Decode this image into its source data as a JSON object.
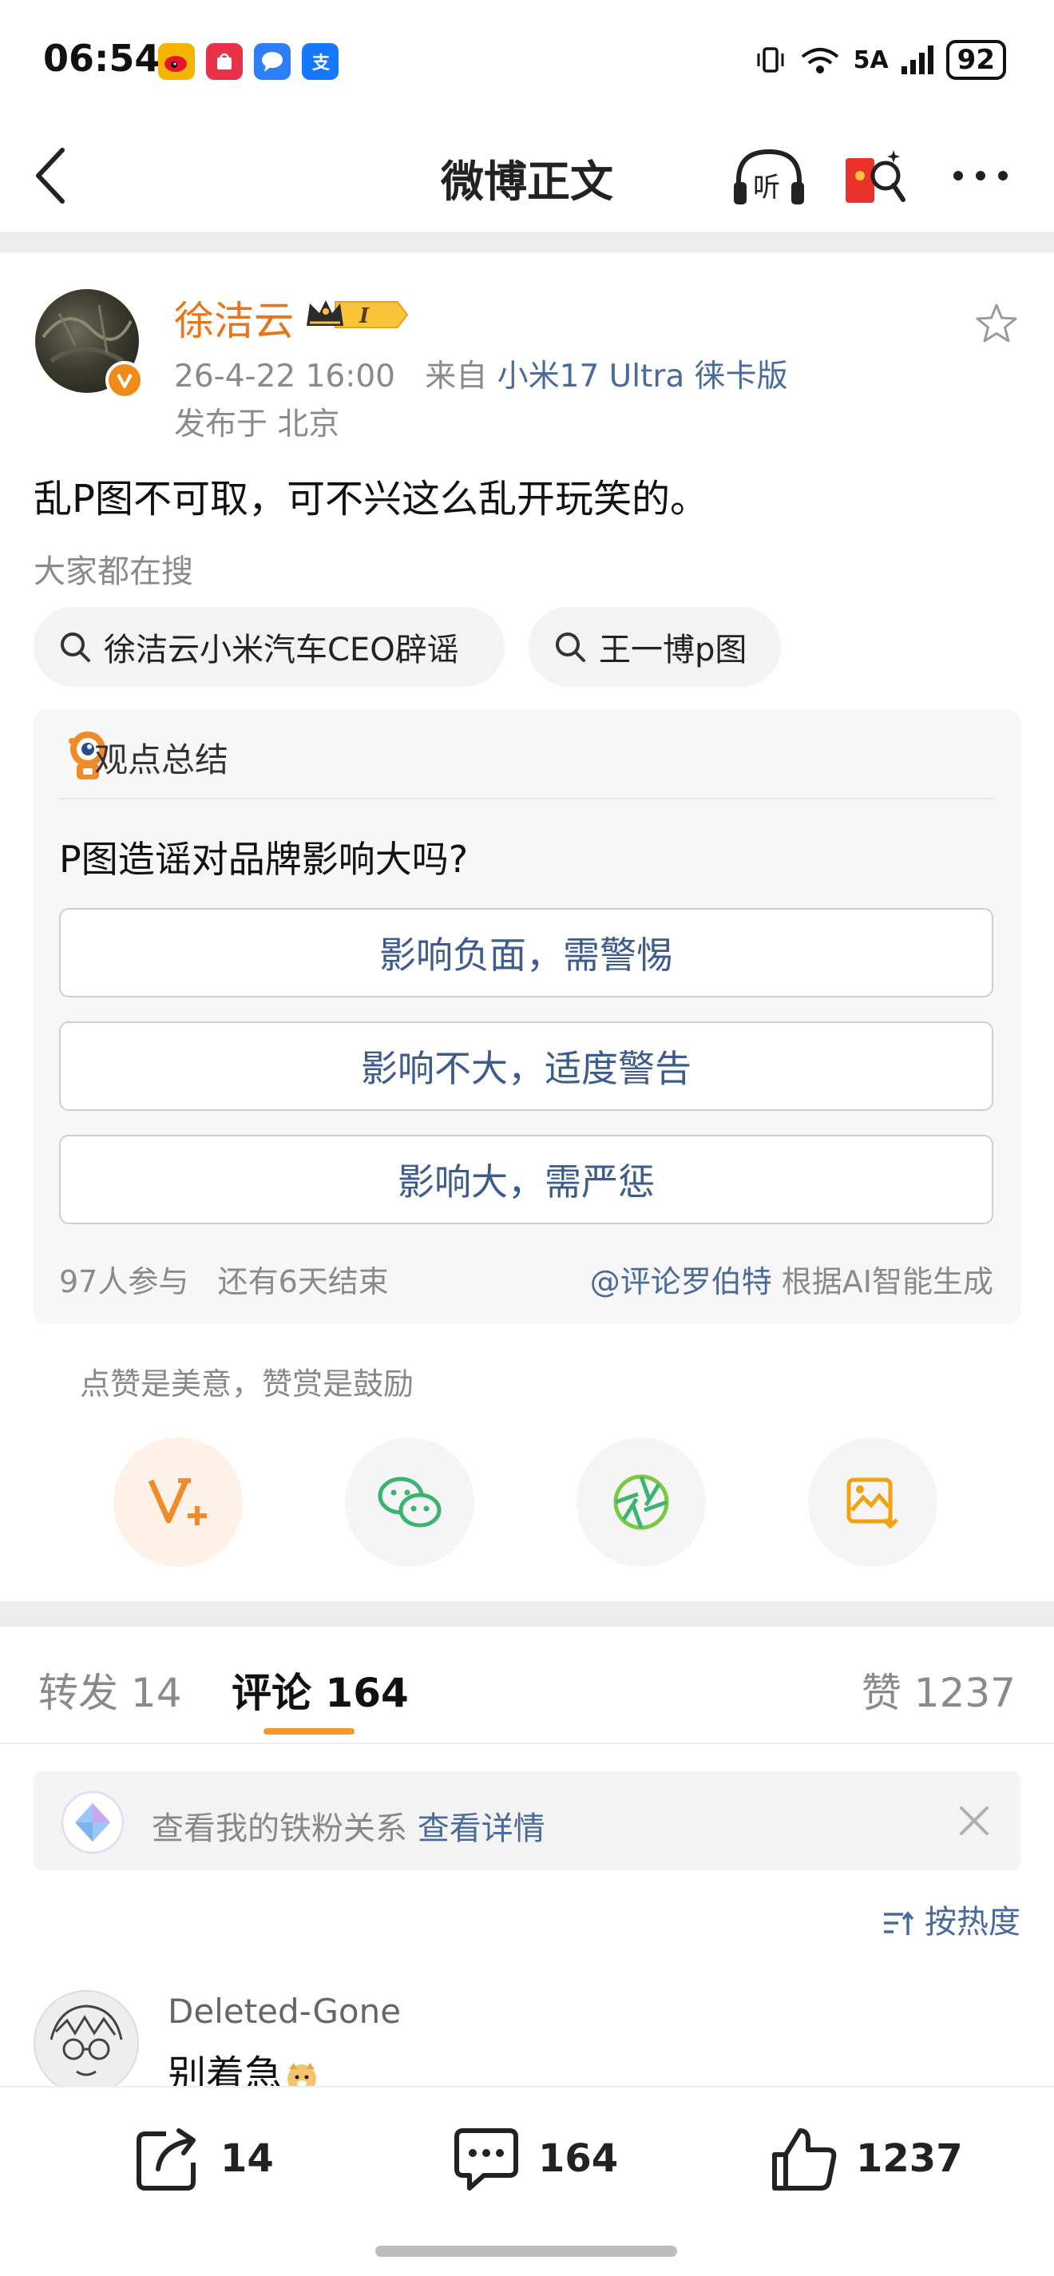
{
  "status_bar": {
    "time": "06:54",
    "network": "5A",
    "battery": "92",
    "apps": [
      "weibo-icon",
      "app-gallery-icon",
      "messages-icon",
      "alipay-icon"
    ]
  },
  "nav": {
    "title": "微博正文",
    "listen_label": "听"
  },
  "post": {
    "author": "徐洁云",
    "badge_text": "I",
    "timestamp": "26-4-22 16:00",
    "from_label": "来自",
    "source": "小米17 Ultra 徕卡版",
    "location": "发布于 北京",
    "text": "乱P图不可取，可不兴这么乱开玩笑的。"
  },
  "search": {
    "label": "大家都在搜",
    "chips": [
      "徐洁云小米汽车CEO辟谣",
      "王一博p图"
    ]
  },
  "poll": {
    "header": "观点总结",
    "question": "P图造谣对品牌影响大吗?",
    "options": [
      "影响负面，需警惕",
      "影响不大，适度警告",
      "影响大，需严惩"
    ],
    "participants": "97人参与",
    "remaining": "还有6天结束",
    "credit_at": "@评论罗伯特",
    "credit_rest": "根据AI智能生成"
  },
  "actions": {
    "hint": "点赞是美意，赞赏是鼓励"
  },
  "tabs": {
    "repost": "转发 14",
    "comments": "评论 164",
    "likes": "赞 1237"
  },
  "fan_bar": {
    "text": "查看我的铁粉关系",
    "link": "查看详情"
  },
  "sort_label": "按热度",
  "comment": {
    "user": "Deleted-Gone",
    "text": "别着急"
  },
  "bottom_bar": {
    "repost_count": "14",
    "comment_count": "164",
    "like_count": "1237"
  },
  "colors": {
    "accent_orange": "#e8741c",
    "link_blue": "#4a6a9a",
    "tab_underline": "#f39a2b"
  }
}
